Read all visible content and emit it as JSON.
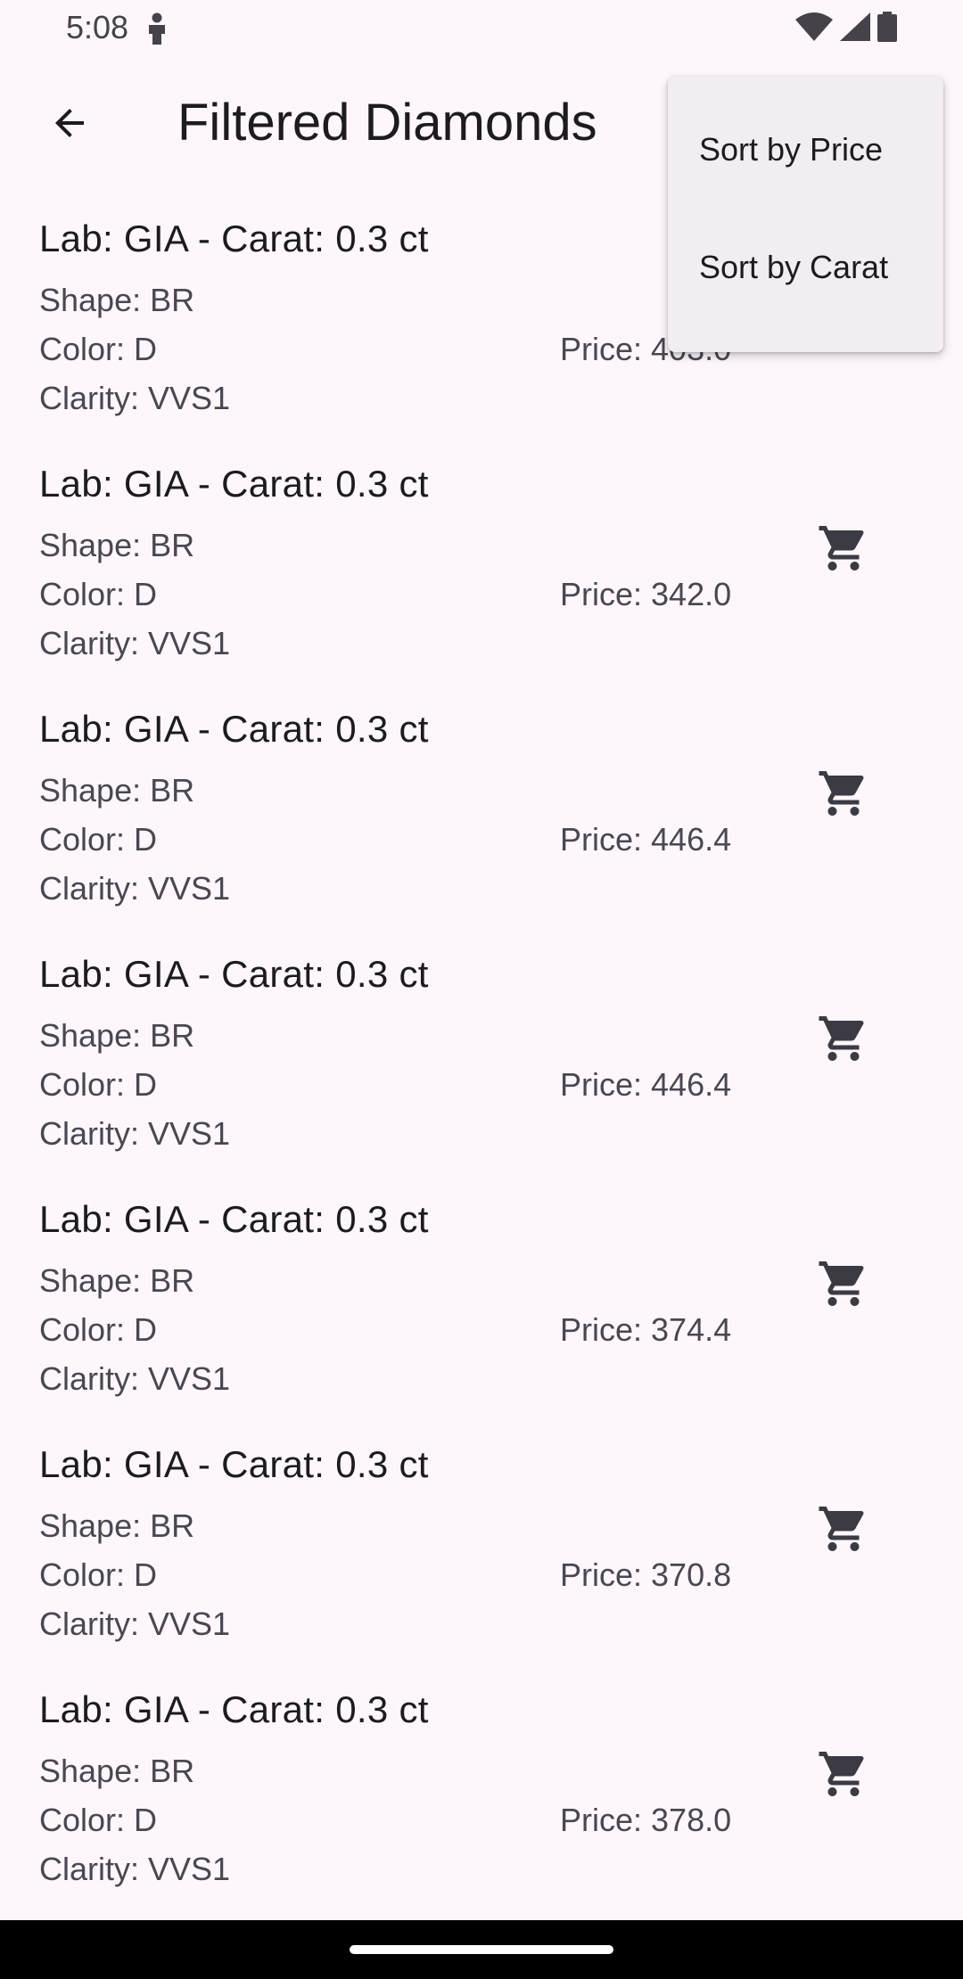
{
  "status_bar": {
    "time": "5:08"
  },
  "app_bar": {
    "title": "Filtered Diamonds",
    "back_icon": "arrow-back-icon"
  },
  "diamonds": [
    {
      "title": "Lab: GIA - Carat: 0.3 ct",
      "shape": "Shape: BR",
      "color": "Color: D",
      "clarity": "Clarity: VVS1",
      "price": "Price: 403.0"
    },
    {
      "title": "Lab: GIA - Carat: 0.3 ct",
      "shape": "Shape: BR",
      "color": "Color: D",
      "clarity": "Clarity: VVS1",
      "price": "Price: 342.0"
    },
    {
      "title": "Lab: GIA - Carat: 0.3 ct",
      "shape": "Shape: BR",
      "color": "Color: D",
      "clarity": "Clarity: VVS1",
      "price": "Price: 446.4"
    },
    {
      "title": "Lab: GIA - Carat: 0.3 ct",
      "shape": "Shape: BR",
      "color": "Color: D",
      "clarity": "Clarity: VVS1",
      "price": "Price: 446.4"
    },
    {
      "title": "Lab: GIA - Carat: 0.3 ct",
      "shape": "Shape: BR",
      "color": "Color: D",
      "clarity": "Clarity: VVS1",
      "price": "Price: 374.4"
    },
    {
      "title": "Lab: GIA - Carat: 0.3 ct",
      "shape": "Shape: BR",
      "color": "Color: D",
      "clarity": "Clarity: VVS1",
      "price": "Price: 370.8"
    },
    {
      "title": "Lab: GIA - Carat: 0.3 ct",
      "shape": "Shape: BR",
      "color": "Color: D",
      "clarity": "Clarity: VVS1",
      "price": "Price: 378.0"
    }
  ],
  "sort_menu": {
    "items": [
      "Sort by Price",
      "Sort by Carat"
    ]
  },
  "colors": {
    "background": "#FDF7FC",
    "menu_background": "#F2EDF3",
    "primary_text": "#1D1B20",
    "secondary_text": "#4A4751"
  }
}
